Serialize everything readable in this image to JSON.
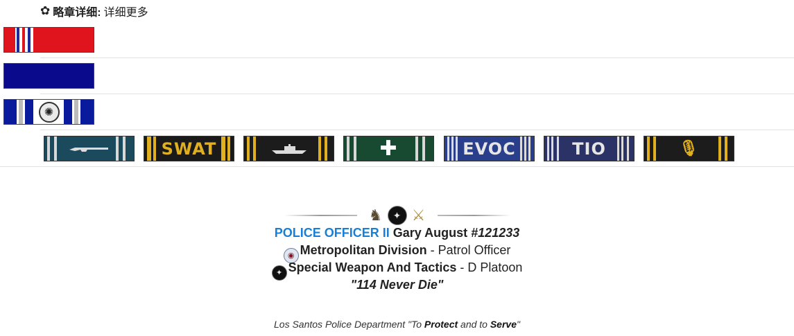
{
  "header": {
    "icon": "gear-icon",
    "title": "略章详细:",
    "subtitle": "详细更多"
  },
  "ribbons": {
    "large": [
      {
        "name": "red-white-blue-ribbon"
      },
      {
        "name": "blue-ribbon"
      },
      {
        "name": "blue-silver-emblem-ribbon"
      }
    ],
    "qualifications": [
      {
        "name": "shotgun-ribbon",
        "label": ""
      },
      {
        "name": "swat-ribbon",
        "label": "SWAT"
      },
      {
        "name": "boat-ribbon",
        "label": ""
      },
      {
        "name": "medic-ribbon",
        "label": "✚"
      },
      {
        "name": "evoc-ribbon",
        "label": "EVOC"
      },
      {
        "name": "tio-ribbon",
        "label": "TIO"
      },
      {
        "name": "radio-ribbon",
        "label": "🎙"
      }
    ]
  },
  "signature": {
    "icons": [
      "tactical-team-icon",
      "swat-seal-icon",
      "eagle-icon"
    ],
    "rank": "POLICE OFFICER II",
    "name": "Gary August",
    "badge": "#121233",
    "division": "Metropolitan Division",
    "division_role": " - Patrol Officer",
    "unit": "Special Weapon And Tactics",
    "unit_role": " - D Platoon",
    "motto": "\"114 Never Die\""
  },
  "footer": {
    "prefix": "Los Santos Police Department \"To ",
    "protect": "Protect",
    "middle": " and to ",
    "serve": "Serve",
    "suffix": "\""
  }
}
